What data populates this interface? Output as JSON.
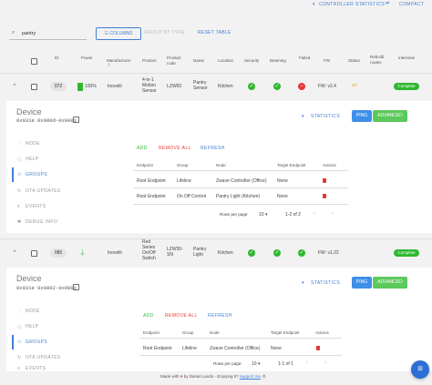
{
  "topbar": {
    "controller_statistics": "CONTROLLER STATISTICS",
    "compact": "COMPACT",
    "arrows": "⇄"
  },
  "toolbar": {
    "search_value": "pantry",
    "columns_label": "COLUMNS",
    "group_by_label": "GROUP BY TYPE",
    "reset_label": "RESET TABLE"
  },
  "table": {
    "headers": [
      "ID",
      "Power",
      "Manufacturer",
      "Product",
      "Product code",
      "Name",
      "Location",
      "Security",
      "Beaming",
      "Failed",
      "FW",
      "Status",
      "Rebuild routes",
      "Interview"
    ],
    "rows": [
      {
        "id": "072",
        "power": "100%",
        "manufacturer": "Inovelli",
        "product": "4-in-1 Motion Sensor",
        "product_code": "LZW60",
        "name": "Pantry Sensor",
        "location": "Kitchen",
        "fw": "FW: v2.4",
        "interview": "Complete"
      },
      {
        "id": "085",
        "power": "",
        "manufacturer": "Inovelli",
        "product": "Red Series On/Off Switch",
        "product_code": "LZW30-SN",
        "name": "Pantry Light",
        "location": "Kitchen",
        "fw": "FW: v1.22",
        "interview": "Complete"
      }
    ]
  },
  "device_panels": [
    {
      "title": "Device",
      "address": "0x031e 0x000d-0x0001",
      "statistics": "STATISTICS",
      "ping": "PING",
      "advanced": "ADVANCED",
      "sidebar": [
        "NODE",
        "HELP",
        "GROUPS",
        "OTA UPDATES",
        "EVENTS",
        "DEBUG INFO"
      ],
      "actions": {
        "add": "ADD",
        "remove_all": "REMOVE ALL",
        "refresh": "REFRESH"
      },
      "groups_headers": [
        "Endpoint",
        "Group",
        "Node",
        "Target Endpoint",
        "Actions"
      ],
      "groups_rows": [
        {
          "endpoint": "Root Endpoint",
          "group": "Lifeline",
          "node": "Zwave Controller (Office)",
          "target": "None"
        },
        {
          "endpoint": "Root Endpoint",
          "group": "On Off Control",
          "node": "Pantry Light (Kitchen)",
          "target": "None"
        }
      ],
      "pagination": {
        "rows_per_page": "Rows per page:",
        "per_page_value": "10",
        "range": "1-2 of 2"
      }
    },
    {
      "title": "Device",
      "address": "0x031e 0x0002-0x0001",
      "statistics": "STATISTICS",
      "ping": "PING",
      "advanced": "ADVANCED",
      "sidebar": [
        "NODE",
        "HELP",
        "GROUPS",
        "OTA UPDATES",
        "EVENTS"
      ],
      "actions": {
        "add": "ADD",
        "remove_all": "REMOVE ALL",
        "refresh": "REFRESH"
      },
      "groups_headers": [
        "Endpoint",
        "Group",
        "Node",
        "Target Endpoint",
        "Actions"
      ],
      "groups_rows": [
        {
          "endpoint": "Root Endpoint",
          "group": "Lifeline",
          "node": "Zwave Controller (Office)",
          "target": "None"
        }
      ],
      "pagination": {
        "rows_per_page": "Rows per page:",
        "per_page_value": "10",
        "range": "1-1 of 1"
      }
    }
  ],
  "footer": {
    "made_with": "Made with",
    "by": "by Daniel Lando - Enjoying it?",
    "support": "Support me"
  },
  "colors": {
    "accent": "#3f7fd6",
    "ok": "#2eb82e",
    "danger": "#e53935",
    "ping": "#3f8fe8",
    "advanced": "#5cc95c"
  }
}
